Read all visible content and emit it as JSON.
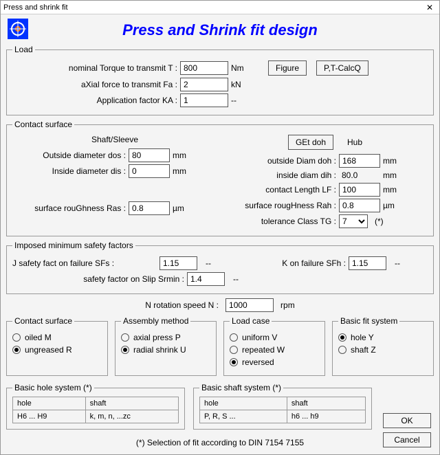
{
  "window": {
    "title": "Press and shrink fit"
  },
  "heading": "Press and Shrink fit design",
  "load": {
    "legend": "Load",
    "torque_lbl": "nominal Torque to transmit   T   :",
    "torque_val": "800",
    "torque_unit": "Nm",
    "axial_lbl": "aXial force to transmit   Fa  :",
    "axial_val": "2",
    "axial_unit": "kN",
    "ka_lbl": "Application factor   KA :",
    "ka_val": "1",
    "ka_unit": "--",
    "figure_btn": "Figure",
    "calc_btn": "P,T-CalcQ"
  },
  "contact": {
    "legend": "Contact surface",
    "shaft_head": "Shaft/Sleeve",
    "hub_head": "Hub",
    "getdoh": "GEt doh",
    "dos_lbl": "Outside diameter   dos :",
    "dos_val": "80",
    "mm": "mm",
    "dis_lbl": "Inside diameter   dis :",
    "dis_val": "0",
    "ras_lbl": "surface rouGhness   Ras :",
    "ras_val": "0.8",
    "um": "µm",
    "doh_lbl": "outside Diam   doh :",
    "doh_val": "168",
    "dih_lbl": "inside diam   dih :",
    "dih_val": "80.0",
    "lf_lbl": "contact Length   LF :",
    "lf_val": "100",
    "rah_lbl": "surface rougHness   Rah :",
    "rah_val": "0.8",
    "tg_lbl": "tolerance  Class TG  :",
    "tg_val": "7",
    "tg_note": "(*)"
  },
  "safety": {
    "legend": "Imposed minimum safety factors",
    "sfs_lbl": "J  safety fact on failure   SFs :",
    "sfs_val": "1.15",
    "dash": "--",
    "sfh_lbl": "K  on failure    SFh :",
    "sfh_val": "1.15",
    "srmin_lbl": "safety factor on Slip   Srmin :",
    "srmin_val": "1.4"
  },
  "speed": {
    "lbl": "N  rotation speed   N :",
    "val": "1000",
    "unit": "rpm"
  },
  "g_surface": {
    "legend": "Contact surface",
    "oiled": "oiled  M",
    "ungreased": "ungreased  R"
  },
  "g_assembly": {
    "legend": "Assembly method",
    "axial": "axial press   P",
    "radial": "radial shrink U"
  },
  "g_load": {
    "legend": "Load case",
    "uniform": "uniform V",
    "repeated": "repeated  W",
    "reversed": "reversed"
  },
  "g_fit": {
    "legend": "Basic fit system",
    "hole": "hole   Y",
    "shaft": "shaft Z"
  },
  "bhs": {
    "legend": "Basic hole system (*)",
    "h": "hole",
    "s": "shaft",
    "hv": "H6 ... H9",
    "sv": "k, m, n, ...zc"
  },
  "bss": {
    "legend": "Basic shaft system (*)",
    "h": "hole",
    "s": "shaft",
    "hv": "P, R, S ...",
    "sv": "h6 ... h9"
  },
  "footnote": "(*) Selection of fit according to DIN 7154 7155",
  "ok": "OK",
  "cancel": "Cancel"
}
